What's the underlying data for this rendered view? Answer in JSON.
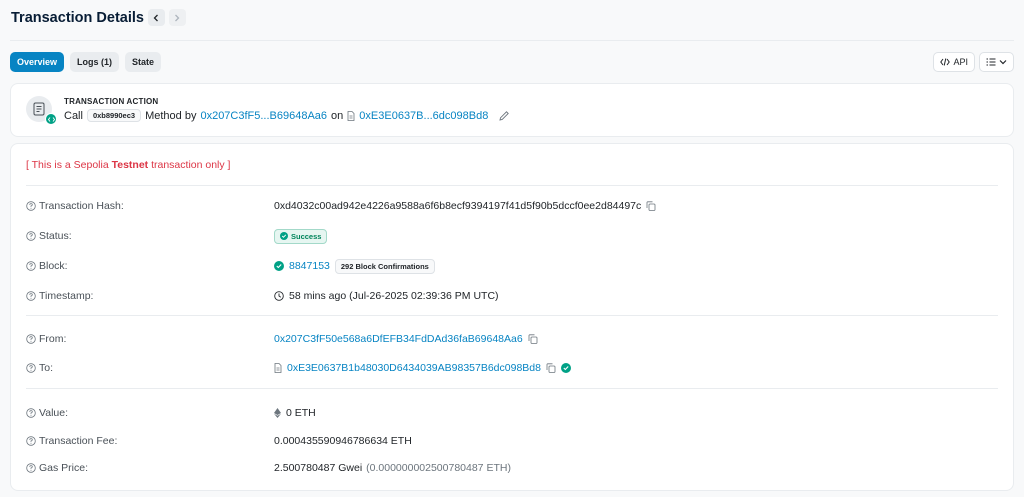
{
  "page": {
    "title": "Transaction Details"
  },
  "tabs": [
    {
      "label": "Overview"
    },
    {
      "label": "Logs (1)"
    },
    {
      "label": "State"
    }
  ],
  "tools": {
    "api_label": "API"
  },
  "action": {
    "title": "TRANSACTION ACTION",
    "call_label": "Call",
    "method_id": "0xb8990ec3",
    "method_by_label": "Method by",
    "from_short": "0x207C3fF5...B69648Aa6",
    "on_label": "on",
    "to_short": "0xE3E0637B...6dc098Bd8"
  },
  "notice": {
    "prefix": "[ This is a Sepolia ",
    "bold": "Testnet",
    "suffix": " transaction only ]"
  },
  "details": {
    "tx_hash": {
      "label": "Transaction Hash:",
      "value": "0xd4032c00ad942e4226a9588a6f6b8ecf9394197f41d5f90b5dccf0ee2d84497c"
    },
    "status": {
      "label": "Status:",
      "value": "Success"
    },
    "block": {
      "label": "Block:",
      "value": "8847153",
      "confirmations": "292 Block Confirmations"
    },
    "timestamp": {
      "label": "Timestamp:",
      "value": "58 mins ago (Jul-26-2025 02:39:36 PM UTC)"
    },
    "from": {
      "label": "From:",
      "value": "0x207C3fF50e568a6DfEFB34FdDAd36faB69648Aa6"
    },
    "to": {
      "label": "To:",
      "value": "0xE3E0637B1b48030D6434039AB98357B6dc098Bd8"
    },
    "value": {
      "label": "Value:",
      "value": "0 ETH"
    },
    "fee": {
      "label": "Transaction Fee:",
      "value": "0.000435590946786634 ETH"
    },
    "gas_price": {
      "label": "Gas Price:",
      "value": "2.500780487 Gwei",
      "eth_value": "(0.000000002500780487 ETH)"
    }
  },
  "colors": {
    "accent": "#0784c3",
    "success": "#00a186",
    "danger": "#dc3545"
  }
}
